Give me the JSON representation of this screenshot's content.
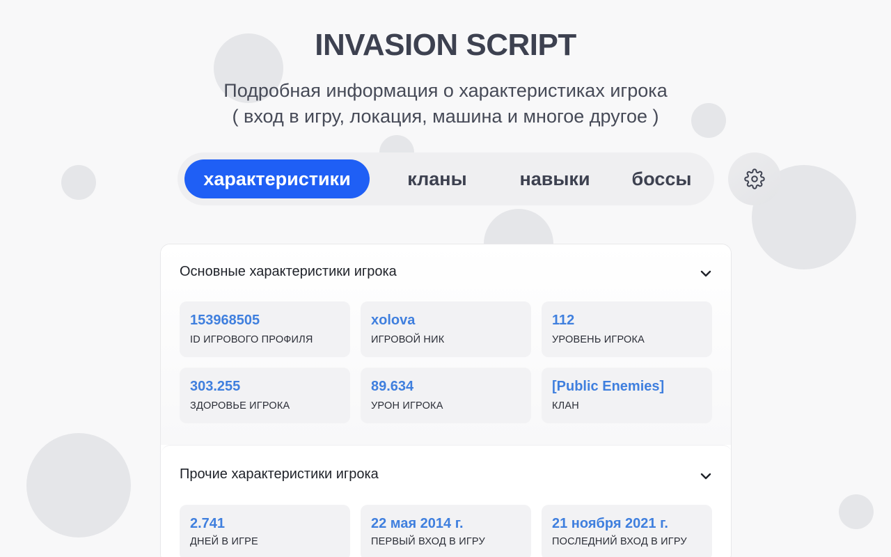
{
  "header": {
    "title": "INVASION SCRIPT",
    "subtitle_line1": "Подробная информация о характеристиках игрока",
    "subtitle_line2": "( вход в игру, локация, машина и многое другое )"
  },
  "tabs": [
    {
      "label": "характеристики",
      "active": true
    },
    {
      "label": "кланы",
      "active": false
    },
    {
      "label": "навыки",
      "active": false
    },
    {
      "label": "боссы",
      "active": false
    }
  ],
  "settings_icon": "gear-icon",
  "colors": {
    "accent": "#1f5ff5",
    "value_text": "#3f7fde",
    "background": "#f8f8f9"
  },
  "sections": [
    {
      "title": "Основные характеристики игрока",
      "expanded": true,
      "cards": [
        {
          "value": "153968505",
          "label": "ID ИГРОВОГО ПРОФИЛЯ"
        },
        {
          "value": "xolova",
          "label": "ИГРОВОЙ НИК"
        },
        {
          "value": "112",
          "label": "УРОВЕНЬ ИГРОКА"
        },
        {
          "value": "303.255",
          "label": "ЗДОРОВЬЕ ИГРОКА"
        },
        {
          "value": "89.634",
          "label": "УРОН ИГРОКА"
        },
        {
          "value": "[Public Enemies]",
          "label": "КЛАН"
        }
      ]
    },
    {
      "title": "Прочие характеристики игрока",
      "expanded": true,
      "cards": [
        {
          "value": "2.741",
          "label": "ДНЕЙ В ИГРЕ"
        },
        {
          "value": "22 мая 2014 г.",
          "label": "ПЕРВЫЙ ВХОД В ИГРУ"
        },
        {
          "value": "21 ноября 2021 г.",
          "label": "ПОСЛЕДНИЙ ВХОД В ИГРУ"
        }
      ]
    }
  ]
}
